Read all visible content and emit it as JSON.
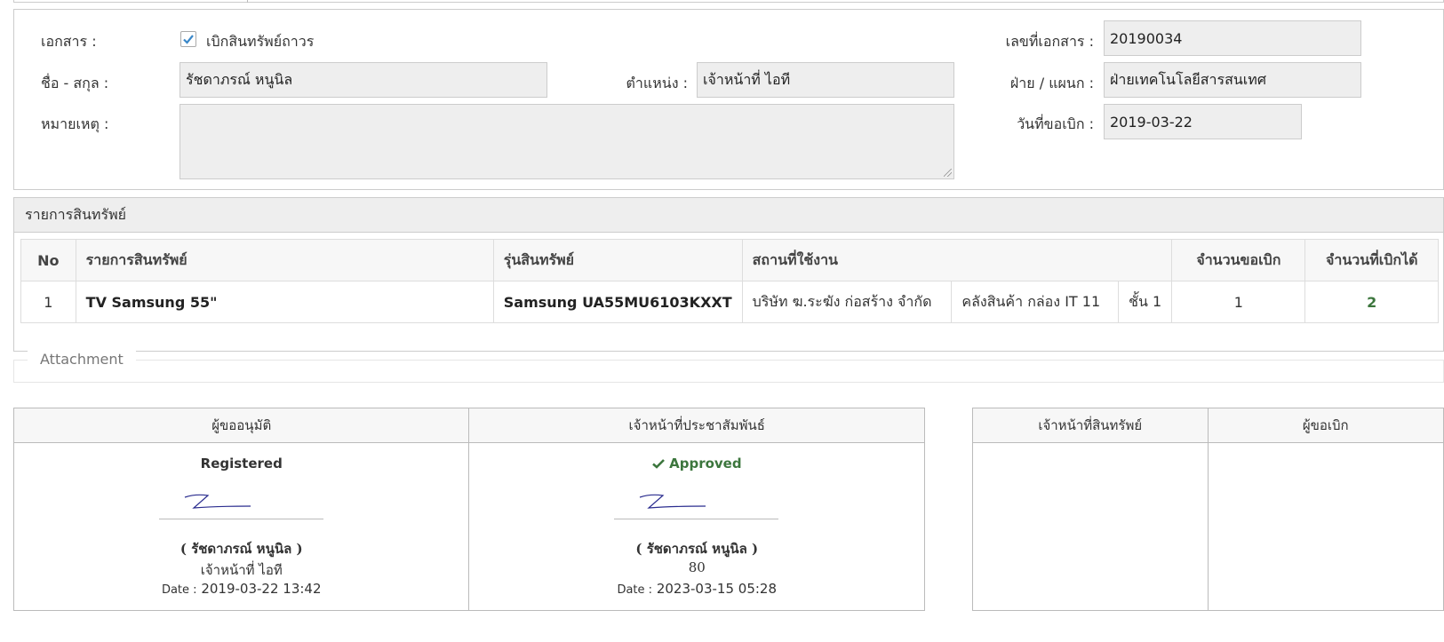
{
  "form": {
    "doc_label": "เอกสาร :",
    "doc_type_checked": true,
    "doc_type_label": "เบิกสินทรัพย์ถาวร",
    "doc_no_label": "เลขที่เอกสาร :",
    "doc_no_value": "20190034",
    "name_label": "ชื่อ - สกุล :",
    "name_value": "รัชดาภรณ์ หนูนิล",
    "position_label": "ตำแหน่ง :",
    "position_value": "เจ้าหน้าที่ ไอที",
    "dept_label": "ฝ่าย / แผนก :",
    "dept_value": "ฝ่ายเทคโนโลยีสารสนเทศ",
    "note_label": "หมายเหตุ :",
    "note_value": "",
    "request_date_label": "วันที่ขอเบิก :",
    "request_date_value": "2019-03-22"
  },
  "assets": {
    "title": "รายการสินทรัพย์",
    "columns": [
      "No",
      "รายการสินทรัพย์",
      "รุ่นสินทรัพย์",
      "สถานที่ใช้งาน",
      "จำนวนขอเบิก",
      "จำนวนที่เบิกได้"
    ],
    "rows": [
      {
        "no": "1",
        "item": "TV Samsung 55\"",
        "model": "Samsung UA55MU6103KXXT",
        "company": "บริษัท ฆ.ระฆัง ก่อสร้าง จำกัด",
        "warehouse": "คลังสินค้า กล่อง IT 11",
        "floor": "ชั้น 1",
        "requested": "1",
        "approved": "2"
      }
    ]
  },
  "attachment": {
    "legend": "Attachment"
  },
  "approvals": {
    "left": [
      {
        "header": "ผู้ขออนุมัติ",
        "status": "Registered",
        "status_ok": false,
        "name": "( รัชดาภรณ์ หนูนิล )",
        "position": "เจ้าหน้าที่ ไอที",
        "date_label": "Date :",
        "date_value": "2019-03-22 13:42"
      },
      {
        "header": "เจ้าหน้าที่ประชาสัมพันธ์",
        "status": "Approved",
        "status_ok": true,
        "name": "( รัชดาภรณ์ หนูนิล )",
        "position": "80",
        "date_label": "Date :",
        "date_value": "2023-03-15 05:28"
      }
    ],
    "right": [
      {
        "header": "เจ้าหน้าที่สินทรัพย์"
      },
      {
        "header": "ผู้ขอเบิก"
      }
    ]
  },
  "colors": {
    "approved_green": "#3c763d",
    "checkbox_blue": "#3a87c8",
    "signature_ink": "#2b2d8f"
  }
}
